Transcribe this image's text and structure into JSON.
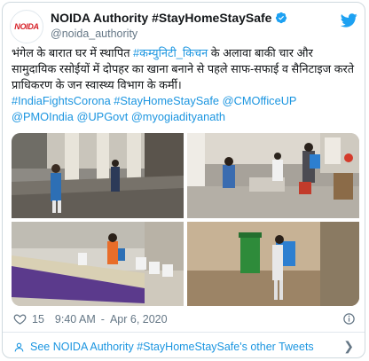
{
  "author": {
    "display_name": "NOIDA Authority #StayHomeStaySafe",
    "handle": "@noida_authority",
    "avatar_text": "NOIDA"
  },
  "tweet": {
    "text_part1": "भंगेल के बारात घर में स्थापित ",
    "hashtag_kitchen": "#कम्युनिटी_किचन",
    "text_part2": " के अलावा बाकी चार और सामुदायिक रसोईयों में दोपहर का खाना बनाने से पहले साफ-सफाई व सैनिटाइज करते प्राधिकरण के जन स्वास्थ्य विभाग के कर्मी।",
    "tags": [
      "#IndiaFightsCorona",
      "#StayHomeStaySafe",
      "@CMOfficeUP",
      "@PMOIndia",
      "@UPGovt",
      "@myogiadityanath"
    ]
  },
  "meta": {
    "likes": "15",
    "time": "9:40 AM",
    "separator": "-",
    "date": "Apr 6, 2020"
  },
  "footer": {
    "see_more": "See NOIDA Authority #StayHomeStaySafe's other Tweets"
  },
  "colors": {
    "link": "#1b95e0",
    "verified": "#1da1f2",
    "twitter_blue": "#1da1f2"
  }
}
